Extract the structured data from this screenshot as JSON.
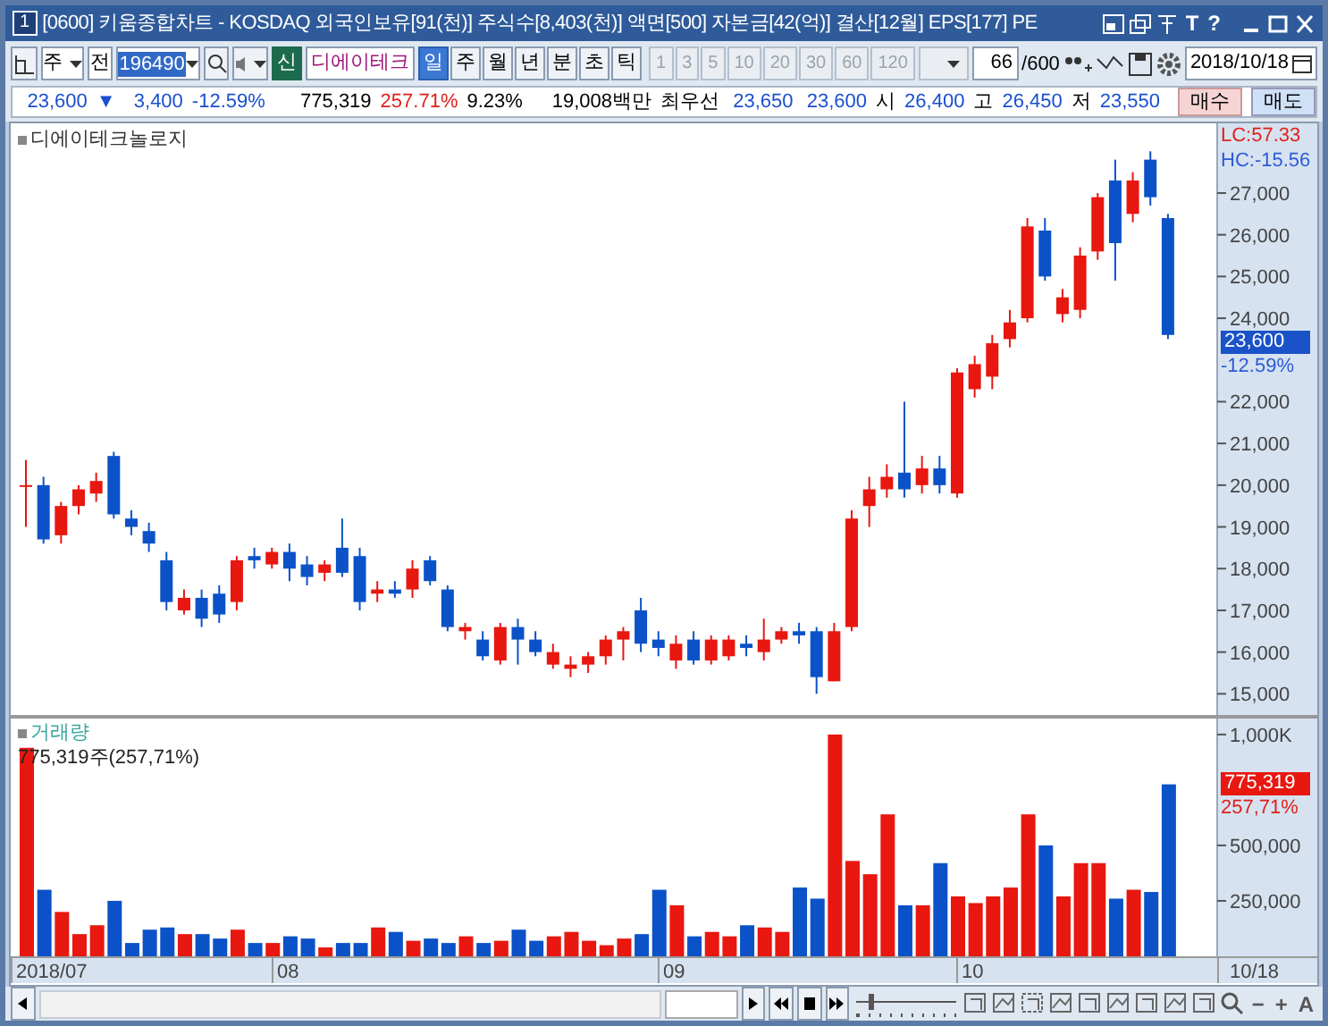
{
  "window": {
    "number": "1",
    "title": "[0600] 키움종합차트 - KOSDAQ 외국인보유[91(천)] 주식수[8,403(천)] 액면[500] 자본금[42(억)] 결산[12월] EPS[177] PE",
    "tools": [
      "T",
      "?"
    ]
  },
  "toolbar": {
    "market": "주",
    "scope": "전",
    "code": "196490",
    "badge": "신",
    "stock_name": "디에이테크",
    "periods": [
      {
        "label": "일",
        "selected": true
      },
      {
        "label": "주",
        "selected": false
      },
      {
        "label": "월",
        "selected": false
      },
      {
        "label": "년",
        "selected": false
      },
      {
        "label": "분",
        "selected": false
      },
      {
        "label": "초",
        "selected": false
      },
      {
        "label": "틱",
        "selected": false
      }
    ],
    "intervals": [
      {
        "label": "1",
        "disabled": true
      },
      {
        "label": "3",
        "disabled": true
      },
      {
        "label": "5",
        "disabled": true
      },
      {
        "label": "10",
        "disabled": true
      },
      {
        "label": "20",
        "disabled": true
      },
      {
        "label": "30",
        "disabled": true
      },
      {
        "label": "60",
        "disabled": true
      },
      {
        "label": "120",
        "disabled": true
      }
    ],
    "count": "66",
    "total": "/600",
    "date": "2018/10/18"
  },
  "quote": {
    "price": "23,600",
    "direction": "▼",
    "change": "3,400",
    "rate": "-12.59%",
    "volume": "775,319",
    "volume_ratio": "257.71%",
    "turnover": "9.23%",
    "amount": "19,008백만",
    "best_label": "최우선",
    "ask": "23,650",
    "bid": "23,600",
    "open_label": "시",
    "open": "26,400",
    "high_label": "고",
    "high": "26,450",
    "low_label": "저",
    "low": "23,550",
    "buy": "매수",
    "sell": "매도"
  },
  "price_panel": {
    "legend": "디에이테크놀로지",
    "lc": "LC:57.33",
    "hc": "HC:-15.56",
    "current_price": "23,600",
    "current_rate": "-12.59%",
    "chart_data": {
      "type": "candlestick",
      "ylim": [
        14450,
        28670
      ],
      "categories": [
        null,
        null,
        null,
        null,
        null,
        null,
        null,
        null,
        null,
        null,
        null,
        null,
        null,
        null,
        null,
        null,
        null,
        null,
        null,
        null,
        null,
        null,
        null,
        null,
        null,
        null,
        null,
        null,
        null,
        null,
        null,
        null,
        null,
        null,
        null,
        null,
        null,
        null,
        null,
        null,
        null,
        null,
        null,
        null,
        null,
        null,
        null,
        null,
        null,
        null,
        null,
        null,
        null,
        null,
        null,
        null,
        null,
        null,
        null,
        null,
        null,
        null,
        null,
        null,
        null,
        null
      ],
      "yticks": [
        {
          "value": 15000,
          "label": "15,000"
        },
        {
          "value": 16000,
          "label": "16,000"
        },
        {
          "value": 17000,
          "label": "17,000"
        },
        {
          "value": 18000,
          "label": "18,000"
        },
        {
          "value": 19000,
          "label": "19,000"
        },
        {
          "value": 20000,
          "label": "20,000"
        },
        {
          "value": 21000,
          "label": "21,000"
        },
        {
          "value": 22000,
          "label": "22,000"
        },
        {
          "value": 24000,
          "label": "24,000"
        },
        {
          "value": 25000,
          "label": "25,000"
        },
        {
          "value": 26000,
          "label": "26,000"
        },
        {
          "value": 27000,
          "label": "27,000"
        }
      ],
      "ohlc": [
        [
          20000,
          20600,
          19000,
          20000
        ],
        [
          20000,
          20200,
          18600,
          18700
        ],
        [
          18800,
          19600,
          18600,
          19500
        ],
        [
          19500,
          20000,
          19300,
          19900
        ],
        [
          19800,
          20300,
          19600,
          20100
        ],
        [
          20700,
          20800,
          19200,
          19300
        ],
        [
          19200,
          19400,
          18800,
          19000
        ],
        [
          18900,
          19100,
          18400,
          18600
        ],
        [
          18200,
          18400,
          17000,
          17200
        ],
        [
          17000,
          17500,
          16900,
          17300
        ],
        [
          17300,
          17500,
          16600,
          16800
        ],
        [
          17400,
          17600,
          16700,
          16900
        ],
        [
          17200,
          18300,
          17000,
          18200
        ],
        [
          18300,
          18500,
          18000,
          18200
        ],
        [
          18100,
          18500,
          18000,
          18400
        ],
        [
          18400,
          18600,
          17700,
          18000
        ],
        [
          18100,
          18300,
          17600,
          17800
        ],
        [
          17900,
          18200,
          17700,
          18100
        ],
        [
          18500,
          19200,
          17800,
          17900
        ],
        [
          18300,
          18500,
          17000,
          17200
        ],
        [
          17400,
          17700,
          17200,
          17500
        ],
        [
          17500,
          17700,
          17300,
          17400
        ],
        [
          17500,
          18200,
          17300,
          18000
        ],
        [
          18200,
          18300,
          17600,
          17700
        ],
        [
          17500,
          17600,
          16500,
          16600
        ],
        [
          16500,
          16700,
          16300,
          16600
        ],
        [
          16300,
          16500,
          15800,
          15900
        ],
        [
          15800,
          16700,
          15700,
          16600
        ],
        [
          16600,
          16800,
          15700,
          16300
        ],
        [
          16300,
          16500,
          15900,
          16000
        ],
        [
          15700,
          16200,
          15600,
          16000
        ],
        [
          15600,
          15900,
          15400,
          15700
        ],
        [
          15700,
          16000,
          15500,
          15900
        ],
        [
          15900,
          16400,
          15700,
          16300
        ],
        [
          16300,
          16600,
          15800,
          16500
        ],
        [
          17000,
          17300,
          16000,
          16200
        ],
        [
          16300,
          16500,
          15900,
          16100
        ],
        [
          15800,
          16400,
          15600,
          16200
        ],
        [
          16300,
          16500,
          15700,
          15800
        ],
        [
          15800,
          16400,
          15700,
          16300
        ],
        [
          15900,
          16400,
          15800,
          16300
        ],
        [
          16200,
          16400,
          15900,
          16100
        ],
        [
          16000,
          16800,
          15800,
          16300
        ],
        [
          16300,
          16600,
          16200,
          16500
        ],
        [
          16500,
          16700,
          16200,
          16400
        ],
        [
          16500,
          16600,
          15000,
          15400
        ],
        [
          15300,
          16700,
          15300,
          16500
        ],
        [
          16600,
          19400,
          16500,
          19200
        ],
        [
          19500,
          20200,
          19000,
          19900
        ],
        [
          19900,
          20500,
          19700,
          20200
        ],
        [
          20300,
          22000,
          19700,
          19900
        ],
        [
          20000,
          20700,
          19800,
          20400
        ],
        [
          20400,
          20700,
          19800,
          20000
        ],
        [
          19800,
          22800,
          19700,
          22700
        ],
        [
          22300,
          23100,
          22100,
          22900
        ],
        [
          22600,
          23600,
          22300,
          23400
        ],
        [
          23500,
          24200,
          23300,
          23900
        ],
        [
          24000,
          26400,
          23900,
          26200
        ],
        [
          26100,
          26400,
          24900,
          25000
        ],
        [
          24100,
          24700,
          23900,
          24500
        ],
        [
          24200,
          25700,
          24000,
          25500
        ],
        [
          25600,
          27000,
          25400,
          26900
        ],
        [
          27300,
          27800,
          24900,
          25800
        ],
        [
          26500,
          27500,
          26300,
          27300
        ],
        [
          27800,
          28000,
          26700,
          26900
        ],
        [
          26400,
          26500,
          23500,
          23600
        ]
      ]
    }
  },
  "volume_panel": {
    "reading": "775,319주(257,71%)",
    "current": "775,319",
    "current_rate": "257,71%",
    "chart_data": {
      "type": "bar",
      "ylim": [
        0,
        1080000
      ],
      "categories": [
        null,
        null,
        null,
        null,
        null,
        null,
        null,
        null,
        null,
        null,
        null,
        null,
        null,
        null,
        null,
        null,
        null,
        null,
        null,
        null,
        null,
        null,
        null,
        null,
        null,
        null,
        null,
        null,
        null,
        null,
        null,
        null,
        null,
        null,
        null,
        null,
        null,
        null,
        null,
        null,
        null,
        null,
        null,
        null,
        null,
        null,
        null,
        null,
        null,
        null,
        null,
        null,
        null,
        null,
        null,
        null,
        null,
        null,
        null,
        null,
        null,
        null,
        null,
        null,
        null,
        null
      ],
      "yticks": [
        {
          "value": 250000,
          "label": "250,000"
        },
        {
          "value": 500000,
          "label": "500,000"
        },
        {
          "value": 1000000,
          "label": "1,000K"
        }
      ],
      "series": [
        {
          "name": "거래량",
          "values": [
            940000,
            300000,
            200000,
            100000,
            140000,
            250000,
            60000,
            120000,
            130000,
            100000,
            100000,
            80000,
            120000,
            60000,
            60000,
            90000,
            80000,
            40000,
            60000,
            60000,
            130000,
            110000,
            70000,
            80000,
            60000,
            90000,
            60000,
            70000,
            120000,
            70000,
            90000,
            110000,
            70000,
            50000,
            80000,
            100000,
            300000,
            230000,
            90000,
            110000,
            90000,
            140000,
            130000,
            110000,
            310000,
            260000,
            1000000,
            430000,
            370000,
            640000,
            230000,
            230000,
            420000,
            270000,
            240000,
            270000,
            310000,
            640000,
            500000,
            270000,
            420000,
            420000,
            260000,
            300000,
            290000,
            775319
          ]
        }
      ]
    }
  },
  "date_axis": {
    "labels": [
      "2018/07",
      "08",
      "09",
      "10"
    ],
    "last": "10/18"
  },
  "bottom_toolbar": {
    "speed": {
      "level": 0.15
    },
    "zoom_out": "−",
    "zoom_in": "+",
    "font": "A"
  }
}
